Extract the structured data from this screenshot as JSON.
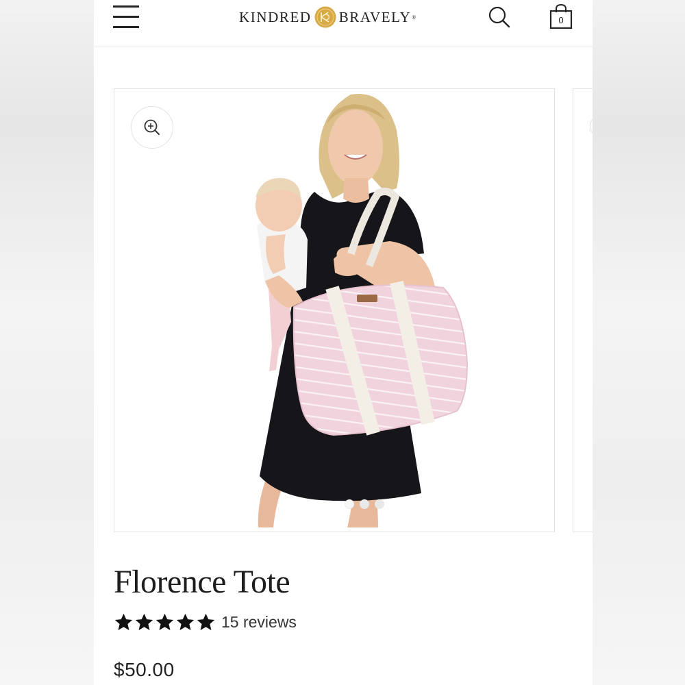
{
  "header": {
    "brand_left": "KINDRED",
    "brand_right": "BRAVELY",
    "brand_reg": "®",
    "cart_count": "0"
  },
  "icons": {
    "menu": "hamburger-icon",
    "logo_mark": "gold-circle-logo-mark",
    "search": "search-icon",
    "cart": "shopping-bag-icon",
    "zoom": "zoom-in-icon",
    "star": "star-icon"
  },
  "gallery": {
    "image_alt": "Florence Tote",
    "slide_count": 3,
    "active_slide": 1
  },
  "product": {
    "title": "Florence Tote",
    "rating": 5,
    "reviews_label": "15 reviews",
    "price": "$50.00"
  },
  "colors": {
    "brand_gold": "#d6a73e",
    "text": "#1d1d1d",
    "tote_pink": "#f1d3dd",
    "dress": "#16161a"
  }
}
